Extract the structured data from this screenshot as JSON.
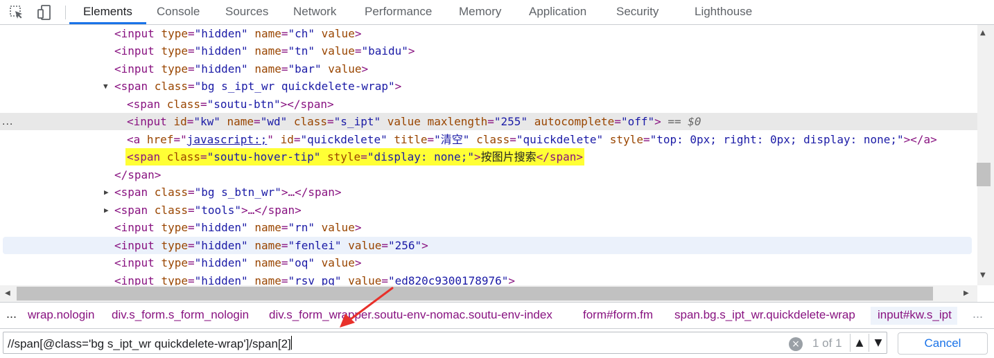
{
  "toolbar": {
    "icons": [
      "inspect-icon",
      "device-toolbar-icon"
    ],
    "tabs": [
      {
        "label": "Elements",
        "active": true
      },
      {
        "label": "Console"
      },
      {
        "label": "Sources"
      },
      {
        "label": "Network"
      },
      {
        "label": "Performance"
      },
      {
        "label": "Memory"
      },
      {
        "label": "Application"
      },
      {
        "label": "Security"
      },
      {
        "label": "Lighthouse"
      }
    ]
  },
  "dom": {
    "lines": [
      {
        "open": "<input ",
        "a1": "type",
        "v1": "\"hidden\"",
        "a2": "name",
        "v2": "\"ch\"",
        "a3": "value",
        "close": ">"
      },
      {
        "open": "<input ",
        "a1": "type",
        "v1": "\"hidden\"",
        "a2": "name",
        "v2": "\"tn\"",
        "a3": "value",
        "v3": "\"baidu\"",
        "close": ">"
      },
      {
        "open": "<input ",
        "a1": "type",
        "v1": "\"hidden\"",
        "a2": "name",
        "v2": "\"bar\"",
        "a3": "value",
        "close": ">"
      },
      {
        "open": "<span ",
        "a1": "class",
        "v1": "\"bg s_ipt_wr quickdelete-wrap\"",
        "close": ">"
      },
      {
        "open": "<span ",
        "a1": "class",
        "v1": "\"soutu-btn\"",
        "close": "></span>"
      },
      {
        "open": "<input ",
        "a1": "id",
        "v1": "\"kw\"",
        "a2": "name",
        "v2": "\"wd\"",
        "a3": "class",
        "v3": "\"s_ipt\"",
        "a4": "value",
        "a5": "maxlength",
        "v5": "\"255\"",
        "a6": "autocomplete",
        "v6": "\"off\"",
        "close": ">",
        "extra": " == $0"
      },
      {
        "open": "<a ",
        "a1": "href",
        "link": "javascript:;",
        "a2": "id",
        "v2": "\"quickdelete\"",
        "a3": "title",
        "v3": "\"清空\"",
        "a4": "class",
        "v4": "\"quickdelete\"",
        "a5": "style",
        "v5": "\"top: 0px; right: 0px; display: none;\"",
        "close": "></a>"
      },
      {
        "open": "<span ",
        "a1": "class",
        "v1": "\"soutu-hover-tip\"",
        "a2": "style",
        "v2": "\"display: none;\"",
        "close": ">",
        "text": "按图片搜索",
        "end": "</span>"
      },
      {
        "close": "</span>"
      },
      {
        "open": "<span ",
        "a1": "class",
        "v1": "\"bg s_btn_wr\"",
        "close": ">…</span>"
      },
      {
        "open": "<span ",
        "a1": "class",
        "v1": "\"tools\"",
        "close": ">…</span>"
      },
      {
        "open": "<input ",
        "a1": "type",
        "v1": "\"hidden\"",
        "a2": "name",
        "v2": "\"rn\"",
        "a3": "value",
        "close": ">"
      },
      {
        "open": "<input ",
        "a1": "type",
        "v1": "\"hidden\"",
        "a2": "name",
        "v2": "\"fenlei\"",
        "a3": "value",
        "v3": "\"256\"",
        "close": ">"
      },
      {
        "open": "<input ",
        "a1": "type",
        "v1": "\"hidden\"",
        "a2": "name",
        "v2": "\"oq\"",
        "a3": "value",
        "close": ">"
      },
      {
        "open": "<input ",
        "a1": "type",
        "v1": "\"hidden\"",
        "a2": "name",
        "v2": "\"rsv_pq\"",
        "a3": "value",
        "v3": "\"ed820c9300178976\"",
        "close": ">"
      }
    ],
    "row_menu": "..."
  },
  "breadcrumbs": {
    "more": "...",
    "items": [
      "wrap.nologin",
      "div.s_form.s_form_nologin",
      "div.s_form_wrapper.soutu-env-nomac.soutu-env-index",
      "form#form.fm",
      "span.bg.s_ipt_wr.quickdelete-wrap",
      "input#kw.s_ipt"
    ],
    "overflow": "..."
  },
  "search": {
    "value": "//span[@class='bg s_ipt_wr quickdelete-wrap']/span[2]",
    "clear": "×",
    "match_count": "1 of 1",
    "prev": "▲",
    "next": "▼",
    "cancel": "Cancel"
  },
  "colors": {
    "accent": "#1a73e8",
    "annotation": "#e8302a",
    "highlight": "#ffff35"
  }
}
